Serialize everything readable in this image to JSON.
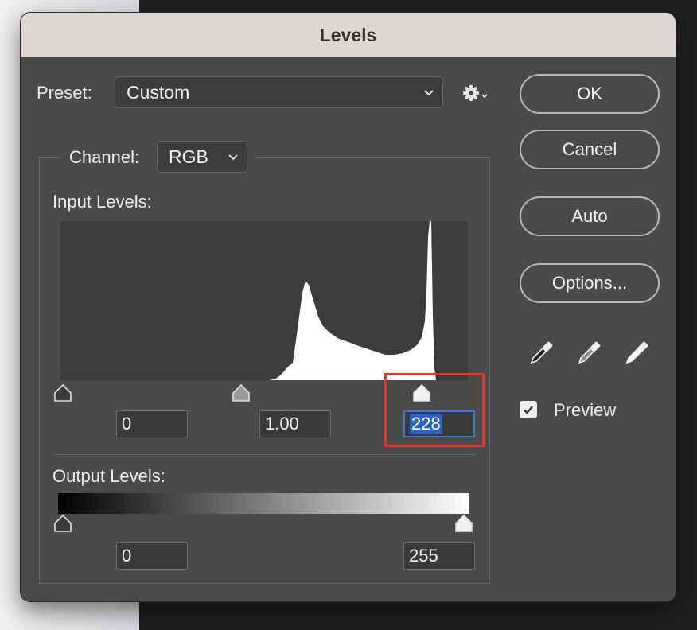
{
  "window": {
    "title": "Levels"
  },
  "preset": {
    "label": "Preset:",
    "value": "Custom"
  },
  "channel": {
    "label": "Channel:",
    "value": "RGB"
  },
  "input_levels": {
    "label": "Input Levels:",
    "black": "0",
    "gamma": "1.00",
    "white": "228"
  },
  "output_levels": {
    "label": "Output Levels:",
    "black": "0",
    "white": "255"
  },
  "buttons": {
    "ok": "OK",
    "cancel": "Cancel",
    "auto": "Auto",
    "options": "Options..."
  },
  "preview": {
    "label": "Preview",
    "checked": true
  },
  "icons": {
    "settings": "gear-icon",
    "eyedroppers": [
      "eyedropper-black-icon",
      "eyedropper-gray-icon",
      "eyedropper-white-icon"
    ]
  },
  "colors": {
    "highlight": "#e03a2a",
    "selection": "#2b61c8"
  }
}
